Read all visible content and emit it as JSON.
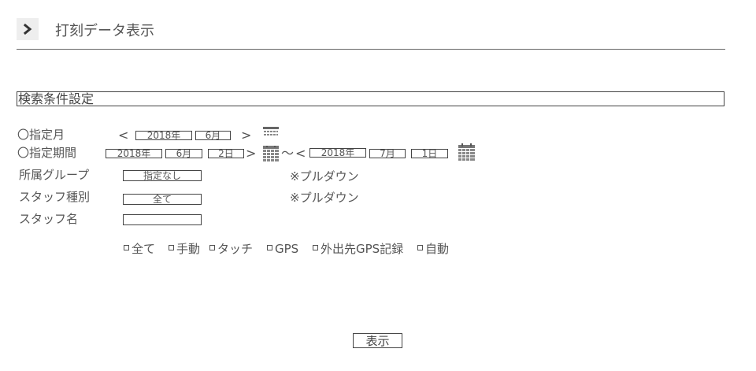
{
  "header": {
    "title": "打刻データ表示",
    "arrow_icon": "chevron-right-icon"
  },
  "section": {
    "title": "検索条件設定"
  },
  "month_row": {
    "label": "〇指定月",
    "prev": "<",
    "year": "2018年",
    "month": "6月",
    "next": ">"
  },
  "period_row": {
    "label": "〇指定期間",
    "from_year": "2018年",
    "from_month": "6月",
    "from_day": "2日",
    "gt": ">",
    "tilde": "〜",
    "lt": "<",
    "to_year": "2018年",
    "to_month": "7月",
    "to_day": "1日"
  },
  "group_row": {
    "label": "所属グループ",
    "value": "指定なし",
    "note": "※プルダウン"
  },
  "type_row": {
    "label": "スタッフ種別",
    "value": "全て",
    "note": "※プルダウン"
  },
  "name_row": {
    "label": "スタッフ名",
    "value": ""
  },
  "filters": [
    "全て",
    "手動",
    "タッチ",
    "GPS",
    "外出先GPS記録",
    "自動"
  ],
  "submit": {
    "label": "表示"
  }
}
